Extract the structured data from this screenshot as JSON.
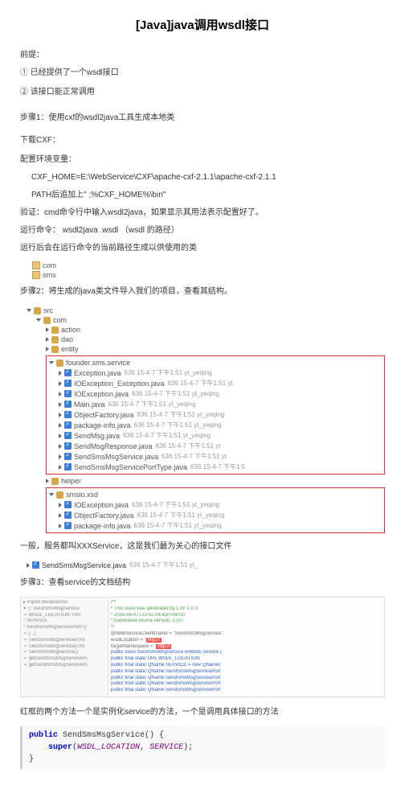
{
  "title": "[Java]java调⽤wsdl接⼝",
  "premise": {
    "label": "前提：",
    "items": [
      "① 已经提供了⼀个wsdl接⼝",
      "② 该接⼝能正常调⽤"
    ]
  },
  "step1": {
    "heading": "步骤1：使⽤cxf的wsdl2java⼯具⽣成本地类",
    "download": "下载CXF：",
    "env_label": "配置环境变量：",
    "env_lines": [
      "CXF_HOME=E:\\WebService\\CXF\\apache-cxf-2.1.1\\apache-cxf-2.1.1",
      "PATH后追加上\" ;%CXF_HOME%\\bin\""
    ],
    "verify": "验证：cmd命令⾏中输⼊wsdl2java，如果显⽰其⽤法表⽰配置好了。",
    "run_cmd": "运⾏命令：  wsdl2java .wsdl    （wsdl 的路径）",
    "run_note": "运⾏后会在运⾏命令的当前路径⽣成以供使⽤的类",
    "tree": [
      "com",
      "sms"
    ]
  },
  "step2": {
    "heading": "步骤2：将⽣成的java类⽂件导⼊我们的项⽬，查看其结构。",
    "src": "src",
    "com": "com",
    "packages": [
      "action",
      "dao",
      "entity"
    ],
    "founder_pkg": "founder.sms.service",
    "founder_files": [
      {
        "n": "Exception.java",
        "m": "636  15-4-7 下午1:51  yt_yeqing"
      },
      {
        "n": "IOException_Exception.java",
        "m": "636  15-4-7 下午1:51  yt"
      },
      {
        "n": "IOException.java",
        "m": "636  15-4-7 下午1:51  yt_yeqing"
      },
      {
        "n": "Main.java",
        "m": "636  15-4-7 下午1:51  yt_yeqing"
      },
      {
        "n": "ObjectFactory.java",
        "m": "636  15-4-7 下午1:51  yt_yeqing"
      },
      {
        "n": "package-info.java",
        "m": "636  15-4-7 下午1:51  yt_yeqing"
      },
      {
        "n": "SendMsg.java",
        "m": "636  15-4-7 下午1:51  yt_yeqing"
      },
      {
        "n": "SendMsgResponse.java",
        "m": "636  15-4-7 下午1:51  yt"
      },
      {
        "n": "SendSmsMsgService.java",
        "m": "636  15-4-7 下午1:51  yt"
      },
      {
        "n": "SendSmsMsgServicePortType.java",
        "m": "636  15-4-7 下午1:5"
      }
    ],
    "helper": "helper",
    "smsio": "smsio.xsd",
    "smsio_files": [
      {
        "n": "IOException.java",
        "m": "636  15-4-7 下午1:51  yt_yeqing"
      },
      {
        "n": "ObjectFactory.java",
        "m": "636  15-4-7 下午1:51  yt_yeqing"
      },
      {
        "n": "package-info.java",
        "m": "636  15-4-7 下午1:51  yt_yeqing"
      }
    ],
    "note": "⼀般，服务都叫XXXService，这是我们最为关⼼的接⼝⽂件",
    "service_file": {
      "n": "SendSmsMsgService.java",
      "m": "636  15-4-7 下午1:51  yt_"
    }
  },
  "step3": {
    "heading": "步骤3：查看service的⽂档结构",
    "left_lines": [
      "▸ import declarations",
      "▾ ⓒ SendSmsMsgService",
      "  ⚬ WSDL_LOCATION: URI",
      "  ° SERVICE",
      "  ° SendSmsMsgServicePortTy",
      "  ⚬ {...}",
      "  ⚬ SendSmsMsgService(URI",
      "  ⚬ SendSmsMsgService(URI",
      "  ⚬ SendSmsMsgService()",
      "  ⚬ getSendSmsMsgServicePo",
      "  ⚬ getSendSmsMsgServicePo"
    ],
    "right_lines": [
      "/**",
      " * This class was generated by CXF 2.0.0",
      " * 2015-04-07T13:51:08.420+08:00",
      " * Generated source version: 2.0.0",
      " */",
      "@WebServiceClient(name = \"SendSmsMsgService\",",
      "                  wsdlLocation = \"http://",
      "                  targetNamespace = \"http://",
      "public class SendSmsMsgService extends Service {",
      "",
      "    public final static URL WSDL_LOCATION;",
      "",
      "    public final static QName SERVICE = new QName(",
      "    public final static QName SendSmsMsgServicePort",
      "    public final static QName SendSmsMsgServicePort",
      "    public final static QName SendSmsMsgServicePort",
      "    public final static QName SendSmsMsgServicePort"
    ],
    "note": "红框的两个⽅法⼀个是实例化service的⽅法，⼀个是调⽤具体接⼝的⽅法"
  },
  "code": {
    "l1_kw": "public",
    "l1_rest": " SendSmsMsgService() {",
    "l2_kw": "super",
    "l2_a": "(",
    "l2_b": "WSDL_LOCATION",
    "l2_c": ", ",
    "l2_d": "SERVICE",
    "l2_e": ");",
    "l3": "}"
  }
}
